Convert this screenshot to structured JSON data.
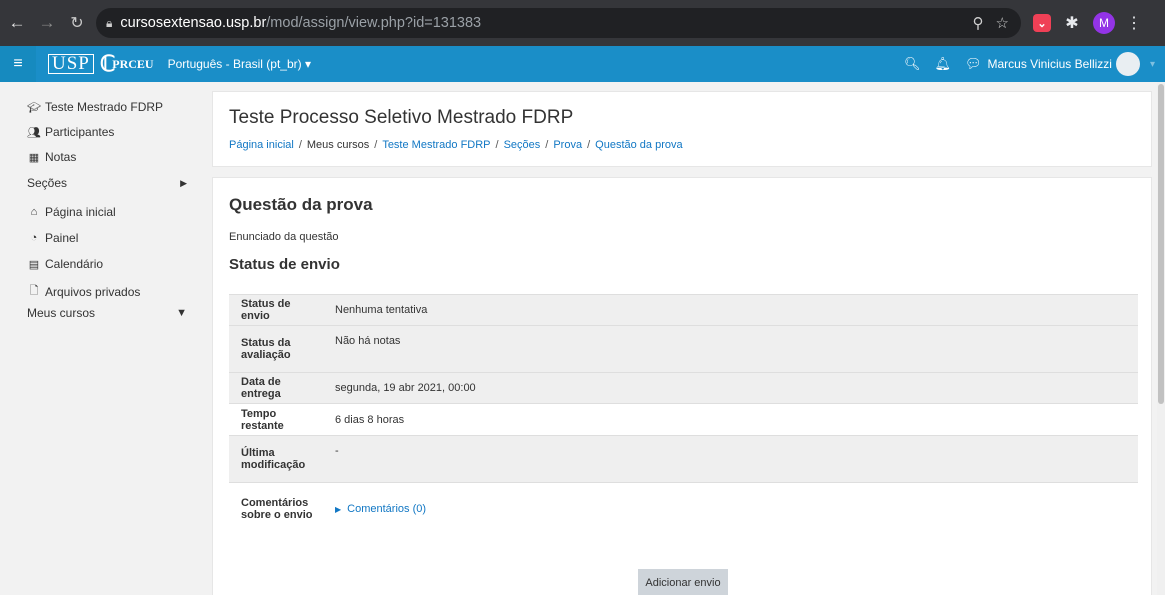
{
  "browser": {
    "url_host": "cursosextensao.usp.br",
    "url_path": "/mod/assign/view.php?id=131383",
    "profile_initial": "M",
    "icons": [
      "back-icon",
      "forward-icon",
      "reload-icon",
      "lock-icon",
      "zoom-icon",
      "star-icon",
      "pocket-icon",
      "extensions-icon",
      "profile-icon",
      "menu-icon"
    ]
  },
  "navbar": {
    "logo_text": "USP",
    "logo_sub": "PRCEU",
    "language": "Português - Brasil (pt_br)",
    "user_name": "Marcus Vinicius Bellizzi",
    "color": "#1a8ec8"
  },
  "sidebar": {
    "items": [
      {
        "label": "Teste Mestrado FDRP",
        "icon": "graduation-cap-icon"
      },
      {
        "label": "Participantes",
        "icon": "users-icon"
      },
      {
        "label": "Notas",
        "icon": "table-icon"
      },
      {
        "label": "Seções",
        "icon": "",
        "arrow": "right"
      },
      {
        "label": "Página inicial",
        "icon": "home-icon"
      },
      {
        "label": "Painel",
        "icon": "dashboard-icon"
      },
      {
        "label": "Calendário",
        "icon": "calendar-icon"
      },
      {
        "label": "Arquivos privados",
        "icon": "file-icon"
      },
      {
        "label": "Meus cursos",
        "icon": "",
        "arrow": "down"
      }
    ]
  },
  "header": {
    "course_title": "Teste Processo Seletivo Mestrado FDRP",
    "breadcrumb": [
      {
        "label": "Página inicial",
        "link": true
      },
      {
        "label": "Meus cursos",
        "link": false
      },
      {
        "label": "Teste Mestrado FDRP",
        "link": true
      },
      {
        "label": "Seções",
        "link": true
      },
      {
        "label": "Prova",
        "link": true
      },
      {
        "label": "Questão da prova",
        "link": true
      }
    ],
    "separator": "/"
  },
  "main": {
    "title": "Questão da prova",
    "intro": "Enunciado da questão",
    "status_heading": "Status de envio",
    "table": [
      {
        "label": "Status de envio",
        "value": "Nenhuma tentativa"
      },
      {
        "label": "Status da avaliação",
        "value": "Não há notas"
      },
      {
        "label": "Data de entrega",
        "value": "segunda, 19 abr 2021, 00:00"
      },
      {
        "label": "Tempo restante",
        "value": "6 dias 8 horas"
      },
      {
        "label": "Última modificação",
        "value": "-"
      },
      {
        "label": "Comentários sobre o envio",
        "value": "Comentários (0)"
      }
    ],
    "add_button": "Adicionar envio"
  }
}
